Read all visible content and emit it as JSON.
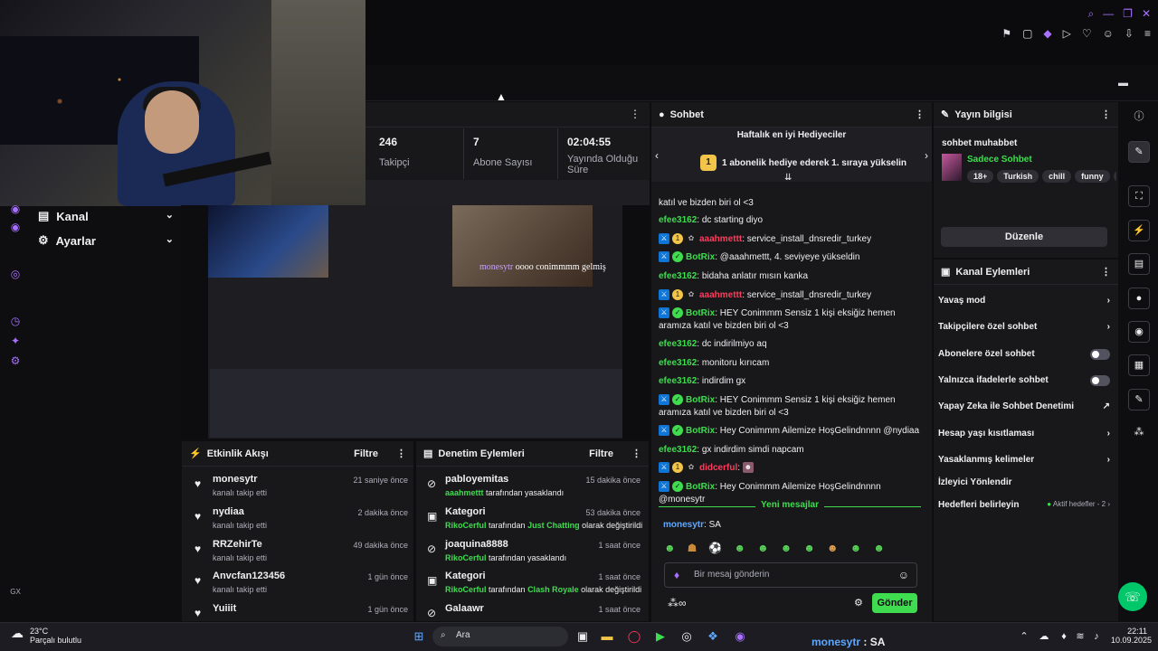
{
  "stats": {
    "followers_value": "246",
    "followers_label": "Takipçi",
    "subs_value": "7",
    "subs_label": "Abone Sayısı",
    "uptime_value": "02:04:55",
    "uptime_label": "Yayında Olduğu Süre"
  },
  "leftnav": {
    "items": [
      {
        "label": "Kanal"
      },
      {
        "label": "Ayarlar"
      }
    ]
  },
  "video": {
    "overlay_user": "monesytr",
    "overlay_text": "oooo conimmmm gelmiş"
  },
  "activity": {
    "title": "Etkinlik Akışı",
    "filter": "Filtre",
    "rows": [
      {
        "name": "monesytr",
        "sub": "kanalı takip etti",
        "time": "21 saniye önce"
      },
      {
        "name": "nydiaa",
        "sub": "kanalı takip etti",
        "time": "2 dakika önce"
      },
      {
        "name": "RRZehirTe",
        "sub": "kanalı takip etti",
        "time": "49 dakika önce"
      },
      {
        "name": "Anvcfan123456",
        "sub": "kanalı takip etti",
        "time": "1 gün önce"
      },
      {
        "name": "Yuiiit",
        "sub": "",
        "time": "1 gün önce"
      }
    ]
  },
  "mod": {
    "title": "Denetim Eylemleri",
    "filter": "Filtre",
    "rows": [
      {
        "name": "pabloyemitas",
        "actor": "aaahmettt",
        "mid": " tarafından yasaklandı",
        "target": "",
        "tail": "",
        "time": "15 dakika önce"
      },
      {
        "name": "Kategori",
        "actor": "RikoCerful",
        "mid": " tarafından ",
        "target": "Just Chatting",
        "tail": " olarak değiştirildi",
        "time": "53 dakika önce"
      },
      {
        "name": "joaquina8888",
        "actor": "RikoCerful",
        "mid": " tarafından yasaklandı",
        "target": "",
        "tail": "",
        "time": "1 saat önce"
      },
      {
        "name": "Kategori",
        "actor": "RikoCerful",
        "mid": " tarafından ",
        "target": "Clash Royale",
        "tail": " olarak değiştirildi",
        "time": "1 saat önce"
      },
      {
        "name": "Galaawr",
        "actor": "",
        "mid": "",
        "target": "",
        "tail": "",
        "time": "1 saat önce"
      }
    ]
  },
  "chat": {
    "title": "Sohbet",
    "gifters_title": "Haftalık en iyi Hediyeciler",
    "gifters_rank": "1",
    "gifters_text": "1 abonelik hediye ederek 1. sıraya yükselin",
    "messages": [
      {
        "user": "",
        "text": "katıl ve bizden biri ol <3",
        "color": ""
      },
      {
        "user": "efee3162",
        "text": ": dc starting diyo",
        "color": "green"
      },
      {
        "user": "aaahmettt",
        "text": ": service_install_dnsredir_turkey",
        "color": "red"
      },
      {
        "user": "BotRix",
        "text": ": @aaahmettt, 4. seviyeye yükseldin",
        "color": "green"
      },
      {
        "user": "efee3162",
        "text": ": bidaha anlatır mısın kanka",
        "color": "green"
      },
      {
        "user": "aaahmettt",
        "text": ": service_install_dnsredir_turkey",
        "color": "red"
      },
      {
        "user": "BotRix",
        "text": ": HEY Conimmm Sensiz 1 kişi eksiğiz hemen aramıza katıl ve bizden biri ol <3",
        "color": "green"
      },
      {
        "user": "efee3162",
        "text": ": dc indirilmiyo aq",
        "color": "green"
      },
      {
        "user": "efee3162",
        "text": ": monitoru kırıcam",
        "color": "green"
      },
      {
        "user": "efee3162",
        "text": ": indirdim gx",
        "color": "green"
      },
      {
        "user": "BotRix",
        "text": ": HEY Conimmm Sensiz 1 kişi eksiğiz hemen aramıza katıl ve bizden biri ol <3",
        "color": "green"
      },
      {
        "user": "BotRix",
        "text": ": Hey Conimmm Ailemize HoşGelindnnnn @nydiaa",
        "color": "green"
      },
      {
        "user": "efee3162",
        "text": ": gx indirdim simdi napcam",
        "color": "green"
      },
      {
        "user": "didcerful",
        "text": ":",
        "color": "red"
      },
      {
        "user": "BotRix",
        "text": ": Hey Conimmm Ailemize HoşGelindnnnn @monesytr",
        "color": "green"
      }
    ],
    "new_messages": "Yeni mesajlar",
    "last_user": "monesytr",
    "last_text": ": SA",
    "input_placeholder": "Bir mesaj gönderin",
    "send_label": "Gönder"
  },
  "info": {
    "title": "Yayın bilgisi",
    "stream_title": "sohbet muhabbet",
    "category": "Sadece Sohbet",
    "tags": [
      "18+",
      "Turkish",
      "chill",
      "funny",
      "T"
    ],
    "edit_label": "Düzenle"
  },
  "channel_actions": {
    "title": "Kanal Eylemleri",
    "items": [
      {
        "label": "Yavaş mod"
      },
      {
        "label": "Takipçilere özel sohbet"
      },
      {
        "label": "Abonelere özel sohbet"
      },
      {
        "label": "Yalnızca ifadelerle sohbet"
      },
      {
        "label": "Yapay Zeka ile Sohbet Denetimi"
      },
      {
        "label": "Hesap yaşı kısıtlaması"
      },
      {
        "label": "Yasaklanmış kelimeler"
      },
      {
        "label": "İzleyici Yönlendir"
      },
      {
        "label": "Hedefleri belirleyin"
      }
    ],
    "goals_status": "Aktif hedefler - 2"
  },
  "taskbar": {
    "weather_temp": "23°C",
    "weather_desc": "Parçalı bulutlu",
    "search_label": "Ara",
    "status_user": "monesytr",
    "status_text": " : SA",
    "time": "22:11",
    "date": "10.09.2025"
  },
  "rail": {
    "gx_label": "GX"
  },
  "colors": {
    "accent_green": "#3fdc4f",
    "accent_purple": "#a970ff",
    "panel_bg": "#18181b",
    "page_bg": "#0e0e10"
  }
}
